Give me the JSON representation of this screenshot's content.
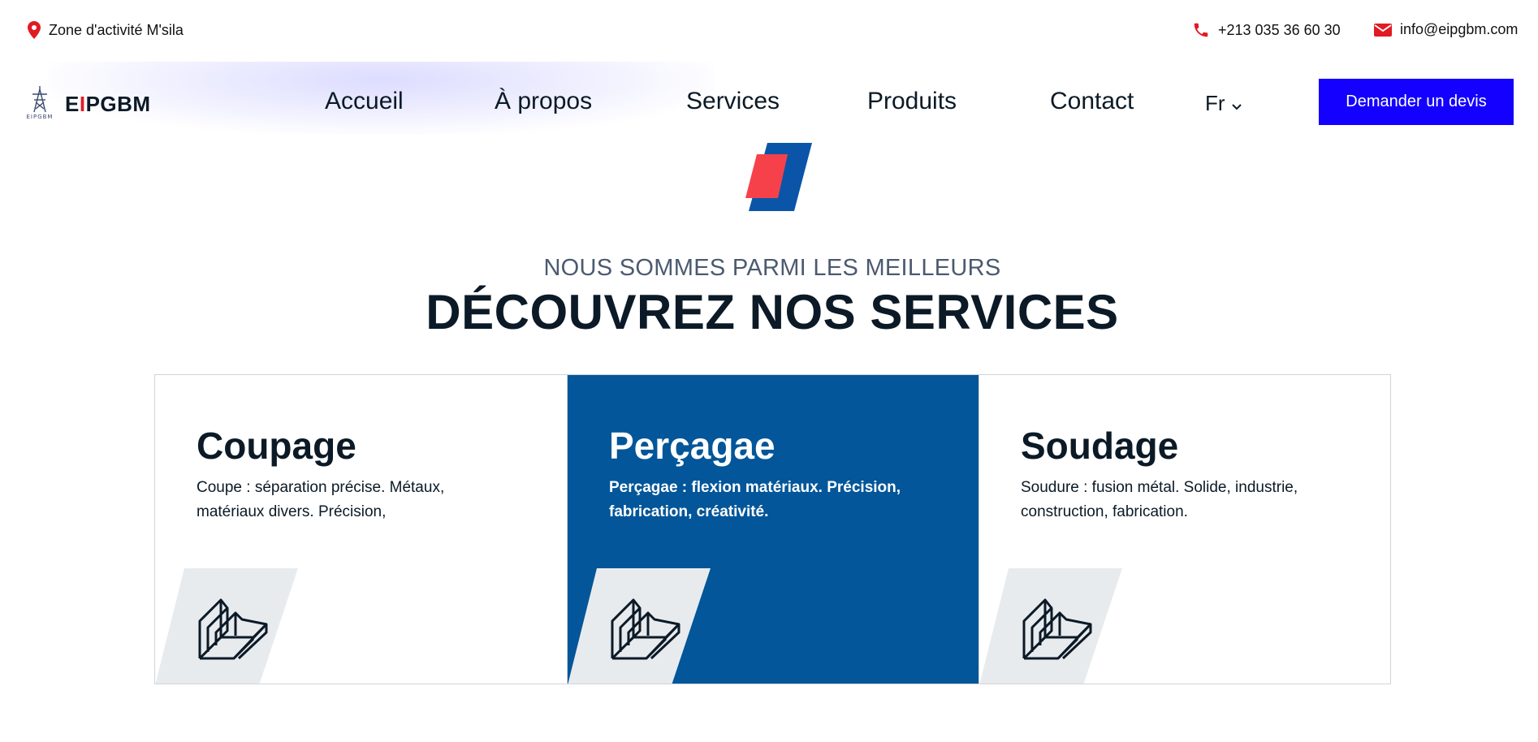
{
  "topbar": {
    "location": "Zone d'activité M'sila",
    "phone": "+213 035 36 60 30",
    "email": "info@eipgbm.com",
    "location_icon": "map-pin-icon",
    "phone_icon": "phone-icon",
    "email_icon": "envelope-icon",
    "icon_color": "#e01b24"
  },
  "navbar": {
    "brand_prefix": "E",
    "brand_red": "I",
    "brand_suffix": "PGBM",
    "logo_icon": "pylon-logo-icon",
    "links": [
      "Accueil",
      "À propos",
      "Services",
      "Produits",
      "Contact"
    ],
    "language": "Fr",
    "cta_label": "Demander un devis",
    "cta_color": "#1300ff"
  },
  "hero": {
    "subtitle": "NOUS SOMMES PARMI LES MEILLEURS",
    "title": "DÉCOUVREZ NOS SERVICES"
  },
  "services": [
    {
      "title": "Coupage",
      "description": "Coupe : séparation précise. Métaux, matériaux divers. Précision,",
      "icon": "steel-angle-icon",
      "active": false
    },
    {
      "title": "Perçagae",
      "description": "Perçagae : flexion matériaux. Précision, fabrication, créativité.",
      "icon": "steel-angle-icon",
      "active": true
    },
    {
      "title": "Soudage",
      "description": "Soudure : fusion métal. Solide, industrie, construction, fabrication.",
      "icon": "steel-angle-icon",
      "active": false
    }
  ],
  "colors": {
    "active_card": "#025699",
    "accent_red": "#f6414b",
    "accent_blue": "#0b55a8"
  }
}
